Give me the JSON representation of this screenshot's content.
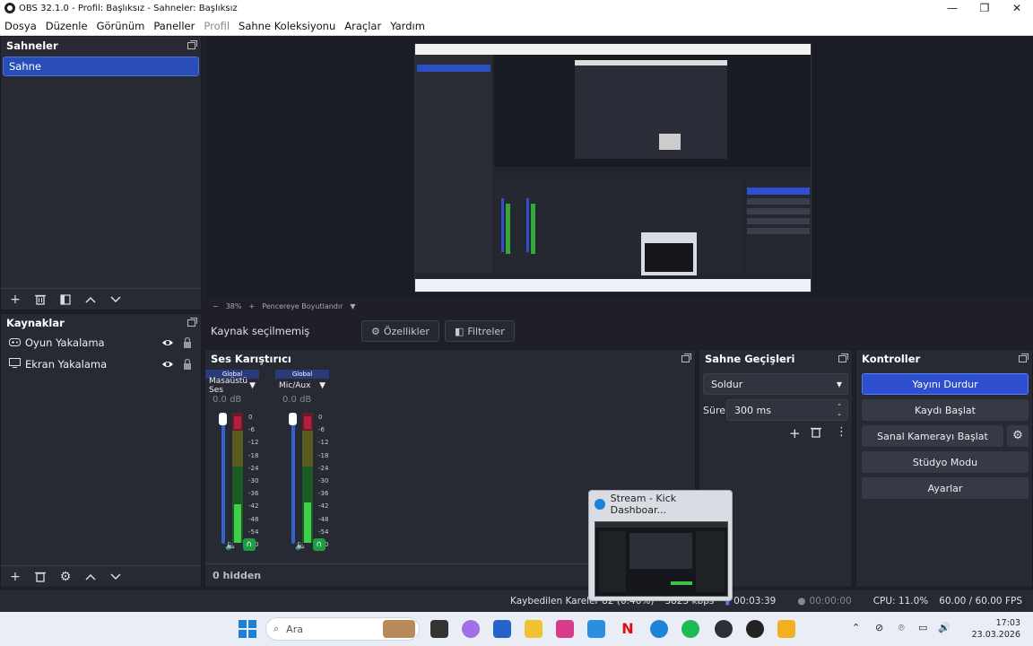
{
  "window": {
    "title": "OBS 32.1.0 - Profil: Başlıksız - Sahneler: Başlıksız",
    "controls": [
      "—",
      "❐",
      "✕"
    ]
  },
  "menu": [
    "Dosya",
    "Düzenle",
    "Görünüm",
    "Paneller",
    "Profil",
    "Sahne Koleksiyonu",
    "Araçlar",
    "Yardım"
  ],
  "scenes": {
    "header": "Sahneler",
    "items": [
      "Sahne"
    ]
  },
  "sources": {
    "header": "Kaynaklar",
    "items": [
      {
        "label": "Oyun Yakalama",
        "icon": "gamepad-icon"
      },
      {
        "label": "Ekran Yakalama",
        "icon": "monitor-icon"
      }
    ]
  },
  "preview": {
    "zoom": "38%",
    "fit_label": "Pencereye Boyutlandır"
  },
  "context": {
    "no_source": "Kaynak seçilmemiş",
    "properties": "Özellikler",
    "filters": "Filtreler"
  },
  "mixer": {
    "header": "Ses Karıştırıcı",
    "hidden_label": "0 hidden",
    "ticks": [
      "0",
      "-6",
      "-12",
      "-18",
      "-24",
      "-30",
      "-36",
      "-42",
      "-48",
      "-54",
      "-60"
    ],
    "channels": [
      {
        "group": "Global",
        "name": "Masaüstü Ses",
        "db": "0.0 dB"
      },
      {
        "group": "Global",
        "name": "Mic/Aux",
        "db": "0.0 dB"
      }
    ]
  },
  "transitions": {
    "header": "Sahne Geçişleri",
    "selected": "Soldur",
    "duration_label": "Süre",
    "duration_value": "300 ms"
  },
  "controls": {
    "header": "Kontroller",
    "stop_stream": "Yayını Durdur",
    "start_recording": "Kaydı Başlat",
    "start_virtualcam": "Sanal Kamerayı Başlat",
    "studio_mode": "Stüdyo Modu",
    "settings": "Ayarlar"
  },
  "status": {
    "dropped_frames": "Kaybedilen Kareler 82 (0.46%)",
    "bitrate": "3825 kbps",
    "stream_time": "00:03:39",
    "rec_time": "00:00:00",
    "cpu": "CPU: 11.0%",
    "fps": "60.00 / 60.00 FPS"
  },
  "thumbnail_popup": {
    "title": "Stream - Kick Dashboar..."
  },
  "taskbar": {
    "search_placeholder": "Ara",
    "time": "17:03",
    "date": "23.03.2026"
  },
  "colors": {
    "accent": "#2d4fd0",
    "panel": "#272a33",
    "background": "#1e1f29"
  }
}
